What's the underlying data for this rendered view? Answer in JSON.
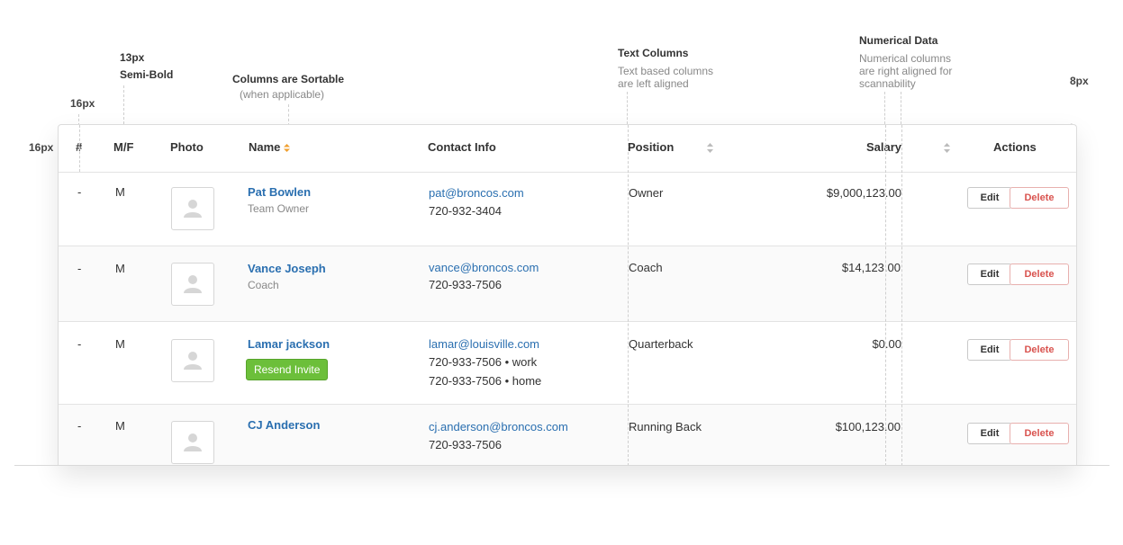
{
  "annotations": {
    "font_size": "13px",
    "font_weight": "Semi-Bold",
    "sortable_title": "Columns are Sortable",
    "sortable_note": "(when applicable)",
    "text_cols_title": "Text Columns",
    "text_cols_line1": "Text based columns",
    "text_cols_line2": "are left aligned",
    "num_title": "Numerical Data",
    "num_line1": "Numerical columns",
    "num_line2": "are right aligned for",
    "num_line3": "scannability",
    "top_spacing": "16px",
    "left_spacing": "16px",
    "radius": "8px"
  },
  "headers": {
    "num": "#",
    "gender": "M/F",
    "photo": "Photo",
    "name": "Name",
    "contact": "Contact Info",
    "position": "Position",
    "salary": "Salary",
    "actions": "Actions"
  },
  "rows": [
    {
      "num": "-",
      "gender": "M",
      "name": "Pat Bowlen",
      "subtitle": "Team Owner",
      "email": "pat@broncos.com",
      "phone1": "720-932-3404",
      "position": "Owner",
      "salary": "$9,000,123.00",
      "edit": "Edit",
      "delete": "Delete"
    },
    {
      "num": "-",
      "gender": "M",
      "name": "Vance Joseph",
      "subtitle": "Coach",
      "email": "vance@broncos.com",
      "phone1": "720-933-7506",
      "position": "Coach",
      "salary": "$14,123.00",
      "edit": "Edit",
      "delete": "Delete"
    },
    {
      "num": "-",
      "gender": "M",
      "name": "Lamar jackson",
      "badge": "Resend Invite",
      "email": "lamar@louisville.com",
      "phone1": "720-933-7506 • work",
      "phone2": "720-933-7506 • home",
      "position": "Quarterback",
      "salary": "$0.00",
      "edit": "Edit",
      "delete": "Delete"
    },
    {
      "num": "-",
      "gender": "M",
      "name": "CJ Anderson",
      "email": "cj.anderson@broncos.com",
      "phone1": "720-933-7506",
      "position": "Running Back",
      "salary": "$100,123.00",
      "edit": "Edit",
      "delete": "Delete"
    }
  ],
  "colors": {
    "link": "#2a6fb0",
    "sort_active": "#f0a030",
    "delete": "#d9534f",
    "badge": "#6cbf3a"
  }
}
